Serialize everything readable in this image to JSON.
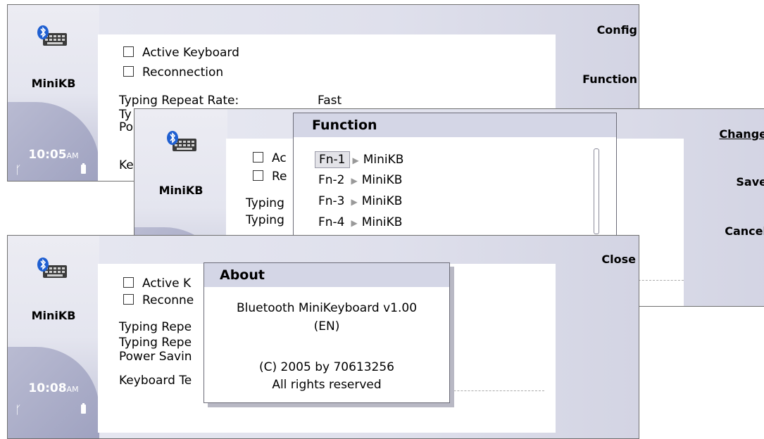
{
  "screens": [
    {
      "app_name": "MiniKB",
      "time": "10:05",
      "ampm": "AM",
      "options": [
        {
          "label": "Active Keyboard"
        },
        {
          "label": "Reconnection"
        }
      ],
      "setting_label": "Typing Repeat Rate:",
      "setting_value": "Fast",
      "partial_rows": [
        "Ty",
        "Po",
        "Ke"
      ],
      "menu": [
        "Config",
        "Function"
      ]
    },
    {
      "app_name": "MiniKB",
      "options": [
        {
          "label": "Ac"
        },
        {
          "label": "Re"
        }
      ],
      "partial_rows": [
        "Typing",
        "Typing"
      ],
      "dialog_title": "Function",
      "fn_items": [
        {
          "key": "Fn-1",
          "target": "MiniKB",
          "selected": true
        },
        {
          "key": "Fn-2",
          "target": "MiniKB",
          "selected": false
        },
        {
          "key": "Fn-3",
          "target": "MiniKB",
          "selected": false
        },
        {
          "key": "Fn-4",
          "target": "MiniKB",
          "selected": false
        }
      ],
      "softkeys": [
        "Change",
        "Save",
        "Cancel"
      ]
    },
    {
      "app_name": "MiniKB",
      "time": "10:08",
      "ampm": "AM",
      "options": [
        {
          "label": "Active K"
        },
        {
          "label": "Reconne"
        }
      ],
      "partial_rows": [
        "Typing Repe",
        "Typing Repe",
        "Power Savin",
        "Keyboard Te"
      ],
      "softkey": "Close",
      "about": {
        "title": "About",
        "line1": "Bluetooth MiniKeyboard v1.00",
        "line2": "(EN)",
        "line3": "(C) 2005 by 70613256",
        "line4": "All rights reserved"
      }
    }
  ]
}
